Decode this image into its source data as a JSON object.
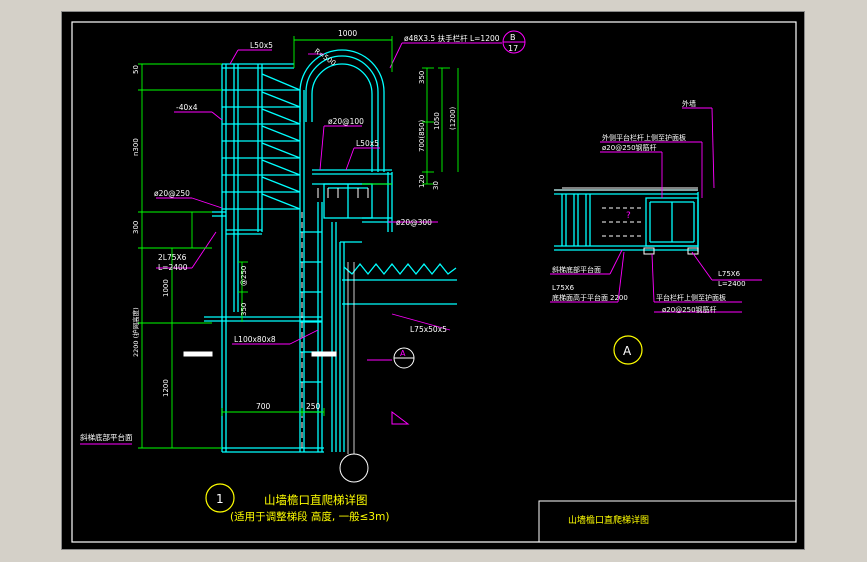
{
  "colors": {
    "background": "#000000",
    "frame": "#ffffff",
    "structure": "#00ffff",
    "dimension": "#00ff00",
    "annotation": "#ff00ff",
    "title": "#ffff00",
    "leader": "#ff00ff",
    "window_bg": "#d4d0c8"
  },
  "main_view": {
    "dimensions": {
      "top_width": "1000",
      "bottom_700": "700",
      "bottom_250": "250",
      "d50": "50",
      "d350": "350",
      "d700": "700(850)",
      "d1050": "1050",
      "d1200": "(1200)",
      "d120": "120",
      "d30": "30",
      "d300": "300",
      "d1000": "1000",
      "d350b": "350",
      "d1200b": "1200",
      "d2200": "2200 (护网高度)",
      "n300": "n300",
      "at250": "@250"
    },
    "labels": {
      "l50x5": "L50x5",
      "r500": "R=500",
      "pipe": "ø48X3.5 扶手栏杆 L=1200",
      "flat": "-40x4",
      "bar100": "ø20@100",
      "l50x5b": "L50x5",
      "bar250": "ø20@250",
      "angle": "2L75X6",
      "l2400": "L=2400",
      "bar300": "ø20@300",
      "l75": "L75x50x5",
      "l100": "L100x80x8",
      "floor": "斜梯底部平台面"
    },
    "callout_b": {
      "letter": "B",
      "sheet": "17"
    },
    "section_a": "A",
    "title_number": "1",
    "title": "山墙檐口直爬梯详图",
    "subtitle": "(适用于调整梯段 高度, 一般≤3m)"
  },
  "section_view": {
    "labels": {
      "outer_wall": "外墙",
      "outer_rail": "外侧平台栏杆上侧至护面板",
      "bar250a": "ø20@250钢筋杆",
      "question": "?",
      "floor": "斜梯底部平台面",
      "l75a": "L75X6",
      "bottom_rail": "底梯面高于平台面",
      "d2200": "2200",
      "l75b": "L75X6",
      "l2400": "L=2400",
      "plat_rail": "平台栏杆上侧至护面板",
      "bar250b": "ø20@250钢筋杆"
    },
    "section_mark": "A"
  },
  "title_block": {
    "title": "山墙檐口直爬梯详图"
  }
}
